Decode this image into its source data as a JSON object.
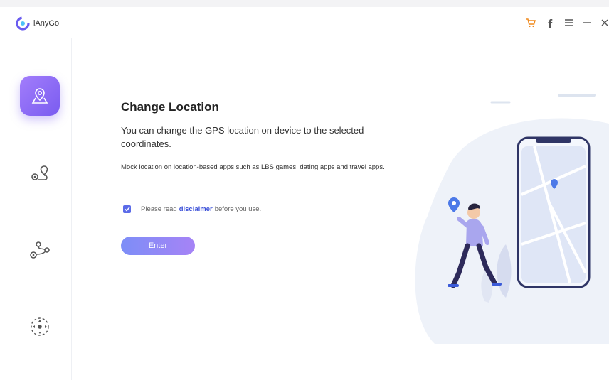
{
  "app": {
    "name": "iAnyGo"
  },
  "titlebar": {
    "buttons": [
      {
        "icon": "cart-icon",
        "color": "#f08a1d"
      },
      {
        "icon": "facebook-icon"
      },
      {
        "icon": "menu-icon"
      },
      {
        "icon": "minimize-icon"
      },
      {
        "icon": "close-icon"
      }
    ]
  },
  "sidebar": {
    "items": [
      {
        "name": "change-location",
        "icon": "location-pin-icon",
        "active": true
      },
      {
        "name": "two-spot-movement",
        "icon": "route-pins-icon",
        "active": false
      },
      {
        "name": "multi-spot-movement",
        "icon": "multi-route-icon",
        "active": false
      },
      {
        "name": "joystick-movement",
        "icon": "joystick-icon",
        "active": false
      }
    ]
  },
  "main": {
    "title": "Change Location",
    "description": "You can change the GPS location on device to the selected coordinates.",
    "note": "Mock location on location-based apps such as LBS games, dating apps and travel apps.",
    "agreement": {
      "checked": true,
      "prefix": "Please read",
      "link": "disclaimer",
      "suffix": "before you use."
    },
    "enter_button": "Enter"
  },
  "colors": {
    "accent": "#7a5cf0",
    "button_gradient": [
      "#7d8ef7",
      "#a683f6"
    ],
    "link": "#3a4fd8",
    "checkbox": "#5b6be8"
  }
}
